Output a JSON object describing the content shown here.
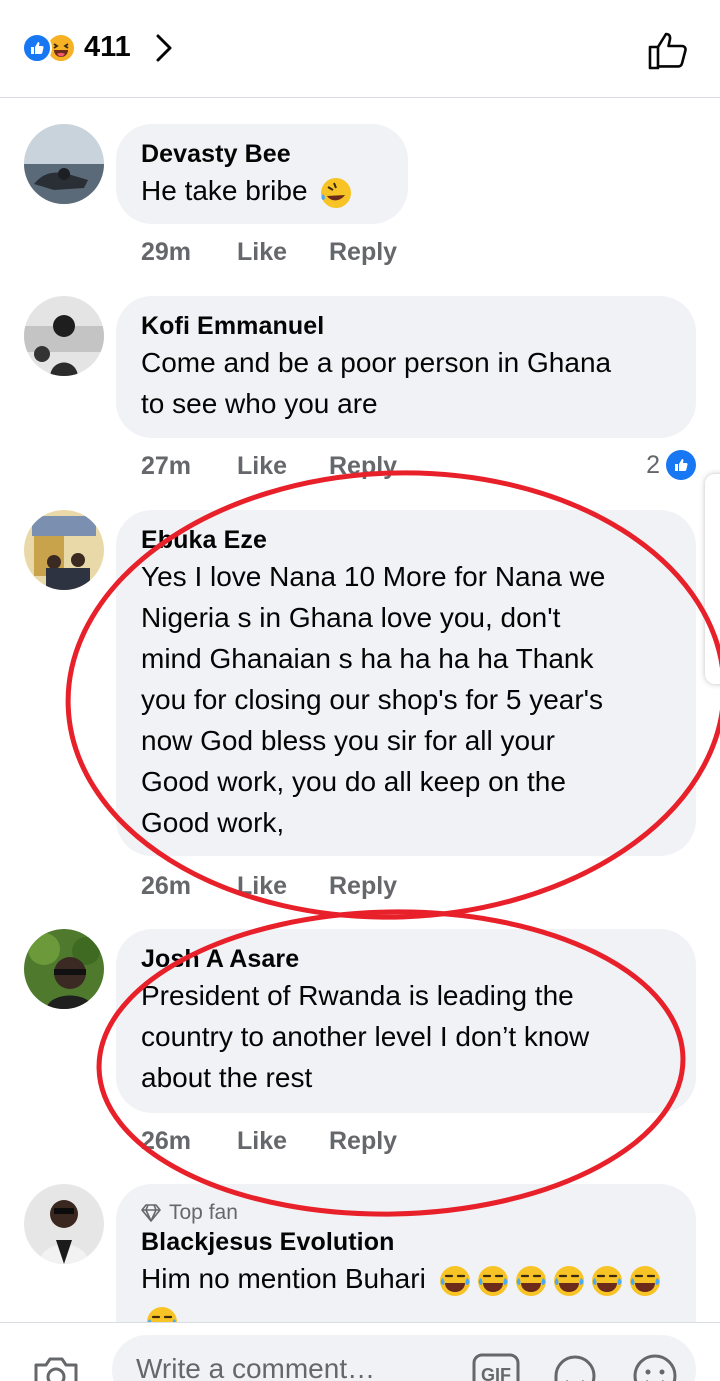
{
  "header": {
    "reaction_count": "411"
  },
  "comments": [
    {
      "author": "Devasty Bee",
      "text": "He take bribe",
      "time": "29m",
      "like": "Like",
      "reply": "Reply",
      "emoji_count": 1
    },
    {
      "author": "Kofi Emmanuel",
      "text_lines": [
        "Come and be a poor person in Ghana",
        "to see who you are"
      ],
      "time": "27m",
      "like": "Like",
      "reply": "Reply",
      "likes_count": "2"
    },
    {
      "author": "Ebuka Eze",
      "text_lines": [
        "Yes I love Nana 10 More for Nana we",
        "Nigeria s in Ghana love you, don't",
        "mind Ghanaian s ha ha ha ha Thank",
        "you for closing our shop's for 5 year's",
        "now God bless you sir for all your",
        "Good work, you do all keep on the",
        "Good work,"
      ],
      "time": "26m",
      "like": "Like",
      "reply": "Reply"
    },
    {
      "author": "Josh A Asare",
      "text_lines": [
        "President of Rwanda is leading the",
        "country to another level I don’t know",
        "about the rest"
      ],
      "time": "26m",
      "like": "Like",
      "reply": "Reply"
    },
    {
      "badge": "Top fan",
      "author": "Blackjesus Evolution",
      "text": "Him no mention Buhari",
      "emoji_count": 7
    }
  ],
  "composer": {
    "placeholder": "Write a comment…",
    "gif_label": "GIF"
  },
  "colors": {
    "brand_blue": "#1877f2",
    "bubble": "#f0f2f5",
    "meta_text": "#65676b",
    "annotation_red": "#e8202a"
  },
  "icons": [
    "like-reaction-icon",
    "haha-reaction-icon",
    "chevron-right-icon",
    "thumbs-up-icon",
    "diamond-icon",
    "camera-icon",
    "gif-icon",
    "sticker-icon",
    "emoji-icon"
  ]
}
